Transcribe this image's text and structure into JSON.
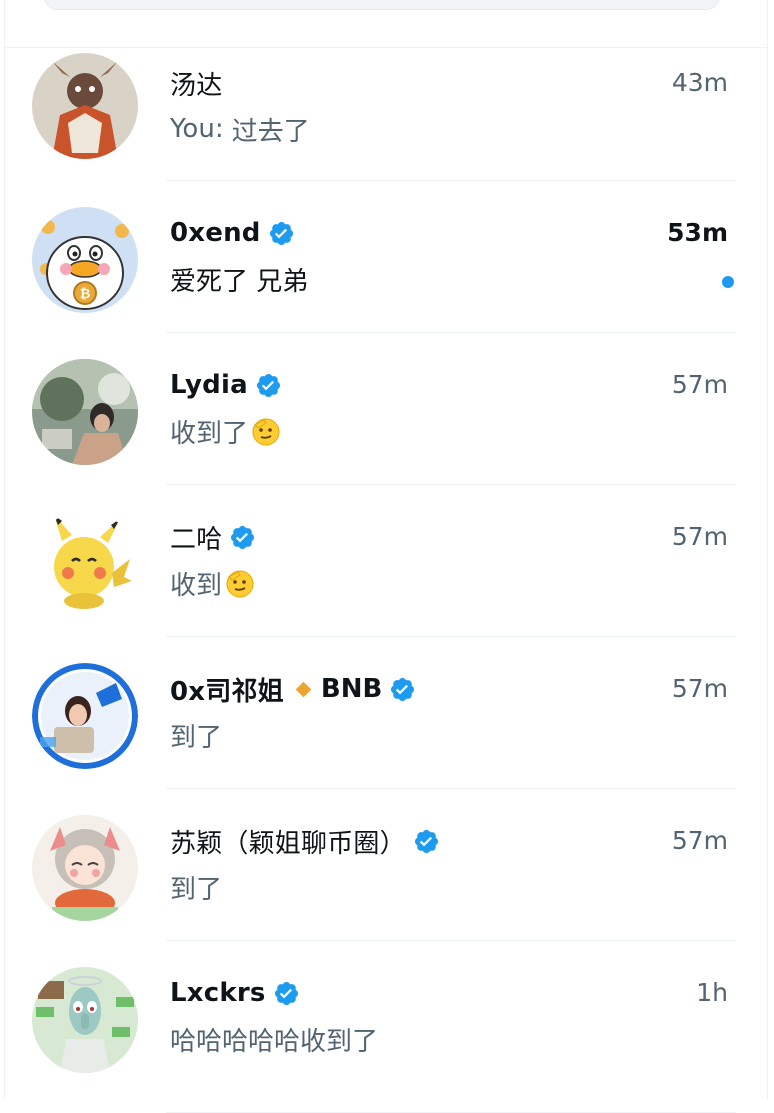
{
  "accent_color": "#1d9bf0",
  "conversations": [
    {
      "name": "汤达",
      "verified": false,
      "time": "43m",
      "preview_prefix": "You:",
      "preview": "过去了",
      "unread": false,
      "avatar": "avatar-illustration-ox-warrior"
    },
    {
      "name": "0xend",
      "verified": true,
      "time": "53m",
      "preview_prefix": "",
      "preview": "爱死了 兄弟",
      "unread": true,
      "avatar": "avatar-duck-bitcoin"
    },
    {
      "name": "Lydia",
      "verified": true,
      "time": "57m",
      "preview_prefix": "",
      "preview": "收到了",
      "emoji": "saluting-face-emoji",
      "unread": false,
      "avatar": "avatar-woman-photo"
    },
    {
      "name": "二哈",
      "verified": true,
      "time": "57m",
      "preview_prefix": "",
      "preview": "收到",
      "emoji": "saluting-face-emoji",
      "unread": false,
      "avatar": "avatar-pikachu"
    },
    {
      "name": "0x司祁姐",
      "badge": "BNB",
      "badge_color": "#f0a429",
      "verified": true,
      "time": "57m",
      "preview_prefix": "",
      "preview": "到了",
      "unread": false,
      "avatar": "avatar-woman-blue-ring"
    },
    {
      "name": "苏颖（颖姐聊币圈）",
      "verified": true,
      "time": "57m",
      "preview_prefix": "",
      "preview": "到了",
      "unread": false,
      "avatar": "avatar-anime-girl"
    },
    {
      "name": "Lxckrs",
      "verified": true,
      "time": "1h",
      "preview_prefix": "",
      "preview": "哈哈哈哈哈收到了",
      "unread": false,
      "avatar": "avatar-squidward-money"
    }
  ]
}
